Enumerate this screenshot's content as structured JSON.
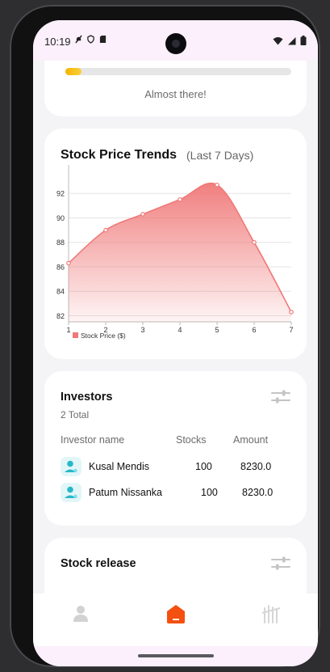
{
  "status_bar": {
    "time": "10:19"
  },
  "progress_card": {
    "progress": 0.07,
    "message": "Almost there!"
  },
  "chart_card": {
    "title": "Stock Price Trends",
    "subtitle": "(Last 7 Days)"
  },
  "chart_data": {
    "type": "area",
    "title": "Stock Price Trends",
    "subtitle": "(Last 7 Days)",
    "x": [
      1,
      2,
      3,
      4,
      5,
      6,
      7
    ],
    "series": [
      {
        "name": "Stock Price ($)",
        "values": [
          86.3,
          89.0,
          90.3,
          91.5,
          92.7,
          88.0,
          82.3
        ],
        "color": "#f07878"
      }
    ],
    "xticks": [
      "1",
      "2",
      "3",
      "4",
      "5",
      "6",
      "7"
    ],
    "yticks": [
      "82",
      "84",
      "86",
      "88",
      "90",
      "92"
    ],
    "ylim": [
      81.5,
      93.8
    ],
    "xlim": [
      1,
      7
    ],
    "grid": "horizontal",
    "legend": "bottom-left"
  },
  "investors_card": {
    "title": "Investors",
    "total": "2 Total",
    "columns": [
      "Investor name",
      "Stocks",
      "Amount"
    ],
    "rows": [
      {
        "name": "Kusal Mendis",
        "stocks": "100",
        "amount": "8230.0"
      },
      {
        "name": "Patum Nissanka",
        "stocks": "100",
        "amount": "8230.0"
      }
    ]
  },
  "stock_release_card": {
    "title": "Stock release"
  },
  "colors": {
    "accent": "#f4500f",
    "progress": "#f6b400",
    "chart": "#f07878",
    "avatar_bg": "#e2f6f8",
    "avatar_fg": "#27b8c8"
  }
}
